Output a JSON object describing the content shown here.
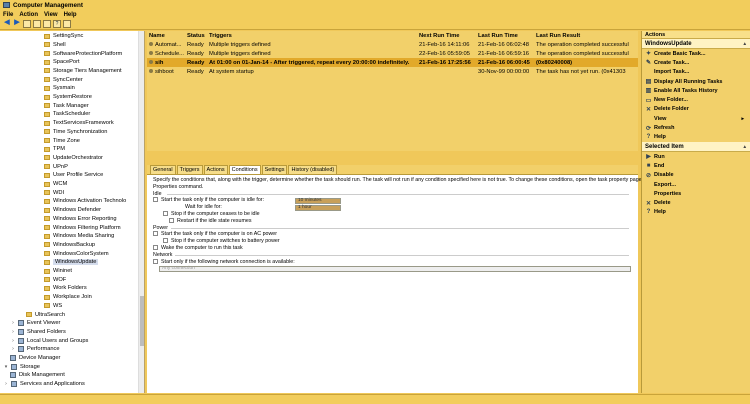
{
  "window": {
    "title": "Computer Management"
  },
  "menu": [
    "File",
    "Action",
    "View",
    "Help"
  ],
  "tree": {
    "items": [
      {
        "label": "SettingSync",
        "depth": 4
      },
      {
        "label": "Shell",
        "depth": 4
      },
      {
        "label": "SoftwareProtectionPlatform",
        "depth": 4
      },
      {
        "label": "SpacePort",
        "depth": 4
      },
      {
        "label": "Storage Tiers Management",
        "depth": 4
      },
      {
        "label": "SyncCenter",
        "depth": 4
      },
      {
        "label": "Sysmain",
        "depth": 4
      },
      {
        "label": "SystemRestore",
        "depth": 4
      },
      {
        "label": "Task Manager",
        "depth": 4
      },
      {
        "label": "TaskScheduler",
        "depth": 4
      },
      {
        "label": "TextServicesFramework",
        "depth": 4
      },
      {
        "label": "Time Synchronization",
        "depth": 4
      },
      {
        "label": "Time Zone",
        "depth": 4
      },
      {
        "label": "TPM",
        "depth": 4
      },
      {
        "label": "UpdateOrchestrator",
        "depth": 4
      },
      {
        "label": "UPnP",
        "depth": 4
      },
      {
        "label": "User Profile Service",
        "depth": 4
      },
      {
        "label": "WCM",
        "depth": 4
      },
      {
        "label": "WDI",
        "depth": 4
      },
      {
        "label": "Windows Activation Technolo",
        "depth": 4
      },
      {
        "label": "Windows Defender",
        "depth": 4
      },
      {
        "label": "Windows Error Reporting",
        "depth": 4
      },
      {
        "label": "Windows Filtering Platform",
        "depth": 4
      },
      {
        "label": "Windows Media Sharing",
        "depth": 4
      },
      {
        "label": "WindowsBackup",
        "depth": 4
      },
      {
        "label": "WindowsColorSystem",
        "depth": 4
      },
      {
        "label": "WindowsUpdate",
        "depth": 4,
        "selected": true
      },
      {
        "label": "Wininet",
        "depth": 4
      },
      {
        "label": "WOF",
        "depth": 4
      },
      {
        "label": "Work Folders",
        "depth": 4
      },
      {
        "label": "Workplace Join",
        "depth": 4
      },
      {
        "label": "WS",
        "depth": 4
      },
      {
        "label": "UltraSearch",
        "depth": 3
      },
      {
        "label": "Event Viewer",
        "depth": 1,
        "expander": ">"
      },
      {
        "label": "Shared Folders",
        "depth": 1,
        "expander": ">"
      },
      {
        "label": "Local Users and Groups",
        "depth": 1,
        "expander": ">"
      },
      {
        "label": "Performance",
        "depth": 1,
        "expander": ">"
      },
      {
        "label": "Device Manager",
        "depth": 1
      },
      {
        "label": "Storage",
        "depth": 0,
        "expander": "v"
      },
      {
        "label": "Disk Management",
        "depth": 1
      },
      {
        "label": "Services and Applications",
        "depth": 0,
        "expander": ">"
      }
    ]
  },
  "tasks": {
    "columns": [
      "Name",
      "Status",
      "Triggers",
      "Next Run Time",
      "Last Run Time",
      "Last Run Result"
    ],
    "rows": [
      {
        "name": "Automat...",
        "status": "Ready",
        "triggers": "Multiple triggers defined",
        "next": "21-Feb-16 14:11:06",
        "last": "21-Feb-16 06:02:48",
        "result": "The operation completed successful"
      },
      {
        "name": "Schedule...",
        "status": "Ready",
        "triggers": "Multiple triggers defined",
        "next": "22-Feb-16 05:59:05",
        "last": "21-Feb-16 06:59:16",
        "result": "The operation completed successful"
      },
      {
        "name": "sih",
        "status": "Ready",
        "triggers": "At 01:00 on 01-Jan-14 - After triggered, repeat every 20:00:00 indefinitely.",
        "next": "21-Feb-16 17:25:56",
        "last": "21-Feb-16 06:00:45",
        "result": "(0x80240008)",
        "selected": true
      },
      {
        "name": "sihboot",
        "status": "Ready",
        "triggers": "At system startup",
        "next": "",
        "last": "30-Nov-99 00:00:00",
        "result": "The task has not yet run. (0x41303"
      }
    ]
  },
  "detail_tabs": [
    "General",
    "Triggers",
    "Actions",
    "Conditions",
    "Settings",
    "History (disabled)"
  ],
  "conditions": {
    "intro": "Specify the conditions that, along with the trigger, determine whether the task should run.  The task will not run  if any condition specified here is not true.  To change these conditions, open the task property pages using the",
    "intro2": "Properties command.",
    "idle_header": "Idle",
    "idle_start": "Start the task only if the computer is idle for:",
    "idle_for_value": "10 minutes",
    "wait_idle": "Wait for idle for:",
    "wait_value": "1 hour",
    "stop_idle": "Stop if the computer ceases to be idle",
    "restart_idle": "Restart if the idle state resumes",
    "power_header": "Power",
    "ac_power": "Start the task only if the computer is on AC power",
    "battery": "Stop if the computer switches to battery power",
    "wake": "Wake the computer to run this task",
    "network_header": "Network",
    "network": "Start only if the following network connection is available:",
    "network_value": "Any connection"
  },
  "actions": {
    "header": "Actions",
    "section1": "WindowsUpdate",
    "items1": [
      {
        "label": "Create Basic Task...",
        "icon": "create-basic-task-icon",
        "glyph": "✦"
      },
      {
        "label": "Create Task...",
        "icon": "create-task-icon",
        "glyph": "✎"
      },
      {
        "label": "Import Task...",
        "icon": "",
        "glyph": ""
      },
      {
        "label": "Display All Running Tasks",
        "icon": "running-tasks-icon",
        "glyph": "▤"
      },
      {
        "label": "Enable All Tasks History",
        "icon": "history-icon",
        "glyph": "▥"
      },
      {
        "label": "New Folder...",
        "icon": "new-folder-icon",
        "glyph": "▭"
      },
      {
        "label": "Delete Folder",
        "icon": "delete-icon",
        "glyph": "✕"
      },
      {
        "label": "View",
        "icon": "",
        "glyph": "",
        "sub": "▸"
      },
      {
        "label": "Refresh",
        "icon": "refresh-icon",
        "glyph": "⟳"
      },
      {
        "label": "Help",
        "icon": "help-icon",
        "glyph": "?"
      }
    ],
    "section2": "Selected Item",
    "items2": [
      {
        "label": "Run",
        "icon": "run-icon",
        "glyph": "▶"
      },
      {
        "label": "End",
        "icon": "end-icon",
        "glyph": "■"
      },
      {
        "label": "Disable",
        "icon": "disable-icon",
        "glyph": "⊘"
      },
      {
        "label": "Export...",
        "icon": "",
        "glyph": ""
      },
      {
        "label": "Properties",
        "icon": "",
        "glyph": ""
      },
      {
        "label": "Delete",
        "icon": "delete-icon",
        "glyph": "✕"
      },
      {
        "label": "Help",
        "icon": "help-icon",
        "glyph": "?"
      }
    ]
  }
}
